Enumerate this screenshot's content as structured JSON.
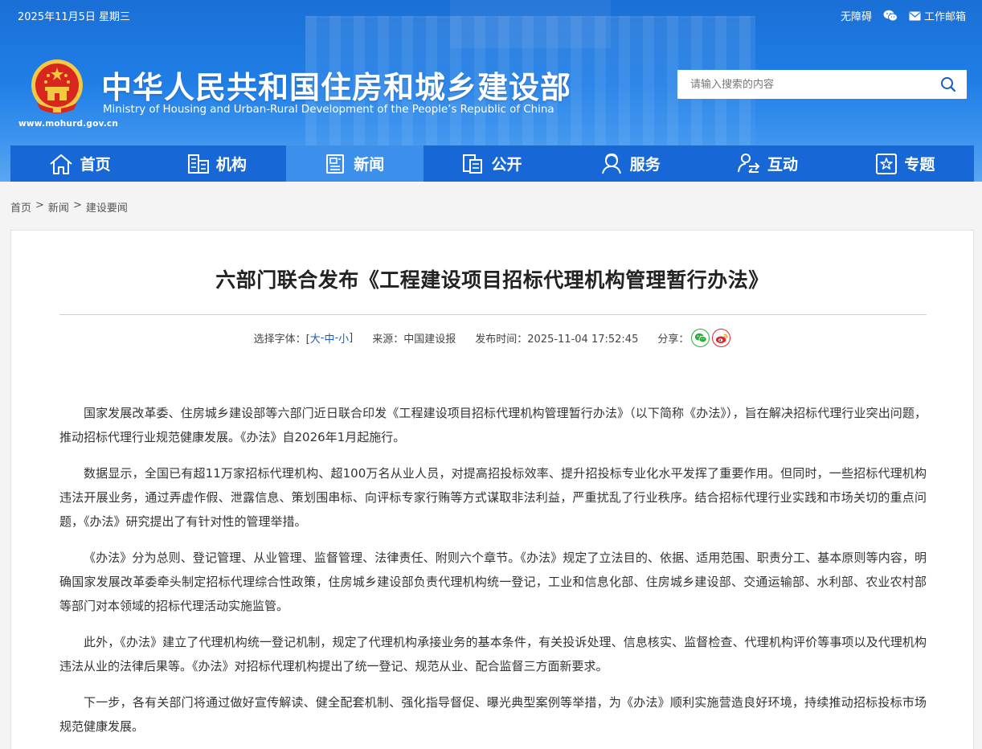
{
  "topbar": {
    "date": "2025年11月5日 星期三",
    "accessibility": "无障碍",
    "work_mail": "工作邮箱"
  },
  "site": {
    "domain": "www.mohurd.gov.cn",
    "title": "中华人民共和国住房和城乡建设部",
    "subtitle": "Ministry of Housing and Urban-Rural Development of the People’s Republic of China"
  },
  "search": {
    "placeholder": "请输入搜索的内容"
  },
  "nav": {
    "items": [
      {
        "label": "首页",
        "icon": "home-icon"
      },
      {
        "label": "机构",
        "icon": "organization-icon"
      },
      {
        "label": "新闻",
        "icon": "news-icon",
        "active": true
      },
      {
        "label": "公开",
        "icon": "disclosure-icon"
      },
      {
        "label": "服务",
        "icon": "service-icon"
      },
      {
        "label": "互动",
        "icon": "interaction-icon"
      },
      {
        "label": "专题",
        "icon": "topic-icon"
      }
    ]
  },
  "breadcrumb": {
    "home": "首页",
    "sep": ">",
    "news": "新闻",
    "current": "建设要闻"
  },
  "article": {
    "title": "六部门联合发布《工程建设项目招标代理机构管理暂行办法》",
    "meta": {
      "font_label": "选择字体：[",
      "font_large": "大",
      "font_medium": "中",
      "font_small": "小",
      "font_dash": " - ",
      "font_close": " ]",
      "source": "来源：中国建设报",
      "published": "发布时间：2025-11-04 17:52:45",
      "share": "分享："
    },
    "paragraphs": [
      "国家发展改革委、住房城乡建设部等六部门近日联合印发《工程建设项目招标代理机构管理暂行办法》（以下简称《办法》），旨在解决招标代理行业突出问题，推动招标代理行业规范健康发展。《办法》自2026年1月起施行。",
      "数据显示，全国已有超11万家招标代理机构、超100万名从业人员，对提高招投标效率、提升招投标专业化水平发挥了重要作用。但同时，一些招标代理机构违法开展业务，通过弄虚作假、泄露信息、策划围串标、向评标专家行贿等方式谋取非法利益，严重扰乱了行业秩序。结合招标代理行业实践和市场关切的重点问题，《办法》研究提出了有针对性的管理举措。",
      "《办法》分为总则、登记管理、从业管理、监督管理、法律责任、附则六个章节。《办法》规定了立法目的、依据、适用范围、职责分工、基本原则等内容，明确国家发展改革委牵头制定招标代理综合性政策，住房城乡建设部负责代理机构统一登记，工业和信息化部、住房城乡建设部、交通运输部、水利部、农业农村部等部门对本领域的招标代理活动实施监管。",
      "此外，《办法》建立了代理机构统一登记机制，规定了代理机构承接业务的基本条件，有关投诉处理、信息核实、监督检查、代理机构评价等事项以及代理机构违法从业的法律后果等。《办法》对招标代理机构提出了统一登记、规范从业、配合监督三方面新要求。",
      "下一步，各有关部门将通过做好宣传解读、健全配套机制、强化指导督促、曝光典型案例等举措，为《办法》顺利实施营造良好环境，持续推动招标投标市场规范健康发展。"
    ]
  },
  "colors": {
    "header_blue": "#1f7ee6",
    "nav_blue": "#1767d6",
    "nav_active": "#3d8fec",
    "link_blue": "#1a5bc4",
    "wechat_green": "#2aae3a",
    "weibo_red": "#e0242b",
    "emblem_red": "#d8261f",
    "emblem_gold": "#f5c842"
  }
}
